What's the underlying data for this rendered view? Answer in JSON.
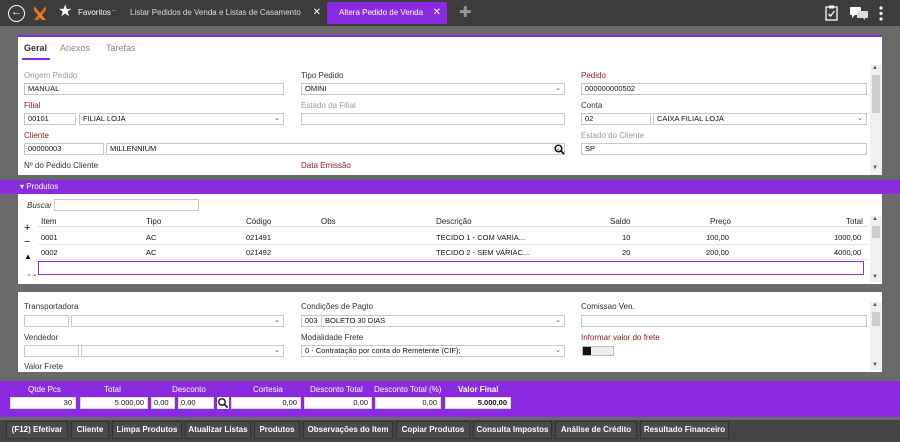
{
  "topbar": {
    "favorites_label": "Favoritos",
    "tabs": [
      {
        "label": "Listar Pedidos de Venda e Listas de Casamento"
      },
      {
        "label": "Altera Pedido de Venda"
      }
    ],
    "close_glyph": "✕",
    "icons": [
      "back-icon",
      "logo-icon",
      "star-icon",
      "plus-icon",
      "clipboard-icon",
      "chat-icon",
      "kebab-icon"
    ]
  },
  "subtabs": [
    "Geral",
    "Anexos",
    "Tarefas"
  ],
  "header_form": {
    "origem_label": "Origem Pedido",
    "origem_value": "MANUAL",
    "tipo_label": "Tipo Pedido",
    "tipo_value": "OMINI",
    "pedido_label": "Pedido",
    "pedido_value": "000000000502",
    "filial_label": "Filial",
    "filial_code": "00101",
    "filial_name": "FILIAL LOJA",
    "estado_filial_label": "Estado da Filial",
    "estado_filial_value": "",
    "conta_label": "Conta",
    "conta_code": "02",
    "conta_name": "CAIXA FILIAL LOJA",
    "cliente_label": "Cliente",
    "cliente_code": "00000003",
    "cliente_name": "MILLENNIUM",
    "estado_cliente_label": "Estado do Cliente",
    "estado_cliente_value": "SP",
    "num_pedido_cliente_label": "Nº do Pedido Cliente",
    "data_emissao_label": "Data Emissão"
  },
  "produtos": {
    "section_title": "Produtos",
    "search_label": "Buscar",
    "columns": [
      "Item",
      "Tipo",
      "Código",
      "Obs",
      "Descrição",
      "Saldo",
      "Preço",
      "Total"
    ],
    "rows": [
      {
        "item": "0001",
        "tipo": "AC",
        "codigo": "021491",
        "obs": "",
        "descricao": "TECIDO 1 - COM VARIA...",
        "saldo": "10",
        "preco": "100,00",
        "total": "1000,00"
      },
      {
        "item": "0002",
        "tipo": "AC",
        "codigo": "021492",
        "obs": "",
        "descricao": "TECIDO 2 - SEM VARIAC...",
        "saldo": "20",
        "preco": "200,00",
        "total": "4000,00"
      }
    ]
  },
  "footer_form": {
    "transportadora_label": "Transportadora",
    "condicoes_label": "Condições de Pagto",
    "condicoes_code": "003",
    "condicoes_name": "BOLETO 30 DIAS",
    "comissao_label": "Comissao Ven.",
    "vendedor_label": "Vendedor",
    "modalidade_label": "Modalidade Frete",
    "modalidade_value": "0 - Contratação por conta do Remetente (CIF);",
    "informar_frete_label": "Informar valor do frete",
    "valor_frete_label": "Valor Frete"
  },
  "totals": {
    "qtde_label": "Qtde Pcs",
    "qtde_value": "30",
    "total_label": "Total",
    "total_value": "5.000,00",
    "desconto_label": "Desconto",
    "desconto_pct": "0,00",
    "desconto_value": "0,00",
    "cortesia_label": "Cortesia",
    "cortesia_value": "0,00",
    "desconto_total_label": "Desconto Total",
    "desconto_total_value": "0,00",
    "desconto_total_pct_label": "Desconto Total (%)",
    "desconto_total_pct_value": "0,00",
    "valor_final_label": "Valor Final",
    "valor_final_value": "5.000,00"
  },
  "buttons": [
    "(F12) Efetivar",
    "Cliente",
    "Limpa Produtos",
    "Atualizar Listas",
    "Produtos",
    "Observações do Item",
    "Copiar Produtos",
    "Consulta Impostos",
    "Análise de Crédito",
    "Resultado Financeiro"
  ],
  "colors": {
    "accent": "#8a2be2",
    "topbar": "#3c3c3c",
    "label_red": "#8b1a1a"
  }
}
